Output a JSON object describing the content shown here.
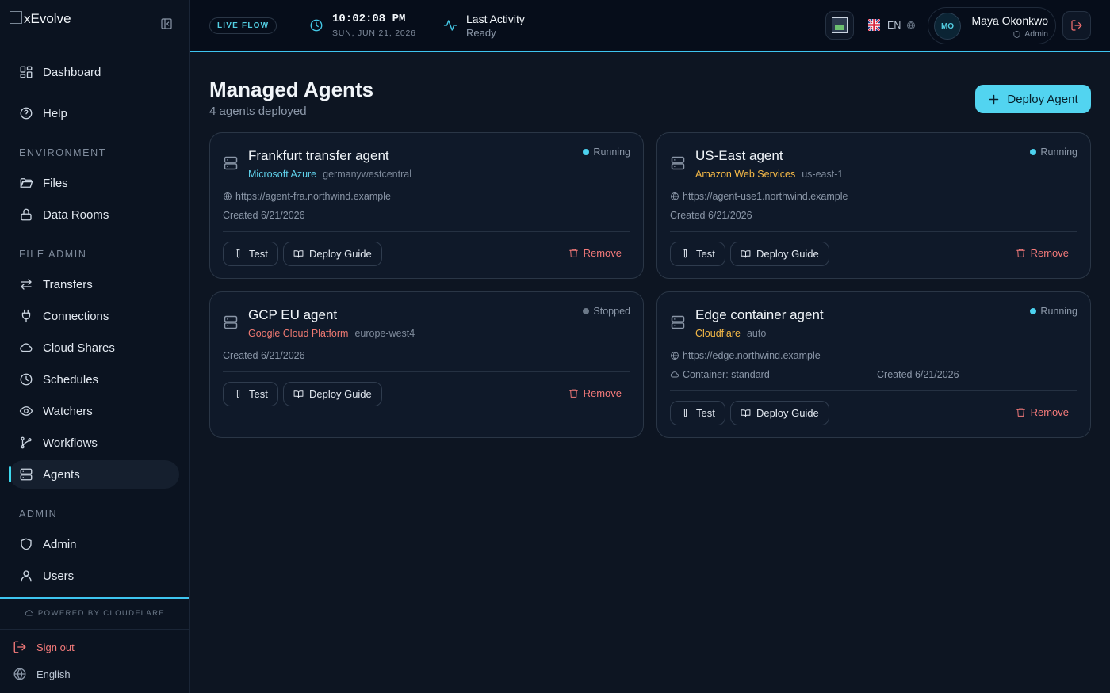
{
  "brand": {
    "name": "xEvolve"
  },
  "sidebar": {
    "top_items": [
      {
        "label": "Dashboard",
        "icon": "dashboard-icon"
      },
      {
        "label": "Help",
        "icon": "help-icon"
      }
    ],
    "sections": [
      {
        "label": "ENVIRONMENT",
        "items": [
          {
            "label": "Files",
            "icon": "folder-icon"
          },
          {
            "label": "Data Rooms",
            "icon": "lock-icon"
          }
        ]
      },
      {
        "label": "FILE ADMIN",
        "items": [
          {
            "label": "Transfers",
            "icon": "transfer-icon"
          },
          {
            "label": "Connections",
            "icon": "plug-icon"
          },
          {
            "label": "Cloud Shares",
            "icon": "cloud-icon"
          },
          {
            "label": "Schedules",
            "icon": "clock-icon"
          },
          {
            "label": "Watchers",
            "icon": "eye-icon"
          },
          {
            "label": "Workflows",
            "icon": "workflow-icon"
          },
          {
            "label": "Agents",
            "icon": "server-icon",
            "active": true
          }
        ]
      },
      {
        "label": "ADMIN",
        "items": [
          {
            "label": "Admin",
            "icon": "shield-icon"
          },
          {
            "label": "Users",
            "icon": "user-icon"
          }
        ]
      }
    ],
    "powered_by": "POWERED BY CLOUDFLARE",
    "sign_out": "Sign out",
    "language": "English"
  },
  "topbar": {
    "live_badge": "LIVE FLOW",
    "time": "10:02:08 PM",
    "date": "SUN, JUN 21, 2026",
    "activity_title": "Last Activity",
    "activity_status": "Ready",
    "lang_code": "EN",
    "user": {
      "initials": "MO",
      "name": "Maya Okonkwo",
      "role": "Admin"
    }
  },
  "main": {
    "title": "Managed Agents",
    "subtitle": "4 agents deployed",
    "deploy_label": "Deploy Agent",
    "test_label": "Test",
    "guide_label": "Deploy Guide",
    "remove_label": "Remove"
  },
  "agents": [
    {
      "name": "Frankfurt transfer agent",
      "provider": "Microsoft Azure",
      "provider_color": "#5fd0ea",
      "region": "germanywestcentral",
      "status": "Running",
      "status_color": "#4cd2ef",
      "url": "https://agent-fra.northwind.example",
      "created": "Created 6/21/2026"
    },
    {
      "name": "US-East agent",
      "provider": "Amazon Web Services",
      "provider_color": "#f5b947",
      "region": "us-east-1",
      "status": "Running",
      "status_color": "#4cd2ef",
      "url": "https://agent-use1.northwind.example",
      "created": "Created 6/21/2026"
    },
    {
      "name": "GCP EU agent",
      "provider": "Google Cloud Platform",
      "provider_color": "#f07a72",
      "region": "europe-west4",
      "status": "Stopped",
      "status_color": "#6b7888",
      "created": "Created 6/21/2026"
    },
    {
      "name": "Edge container agent",
      "provider": "Cloudflare",
      "provider_color": "#f5b947",
      "region": "auto",
      "status": "Running",
      "status_color": "#4cd2ef",
      "url": "https://edge.northwind.example",
      "container": "Container: standard",
      "created": "Created 6/21/2026"
    }
  ]
}
